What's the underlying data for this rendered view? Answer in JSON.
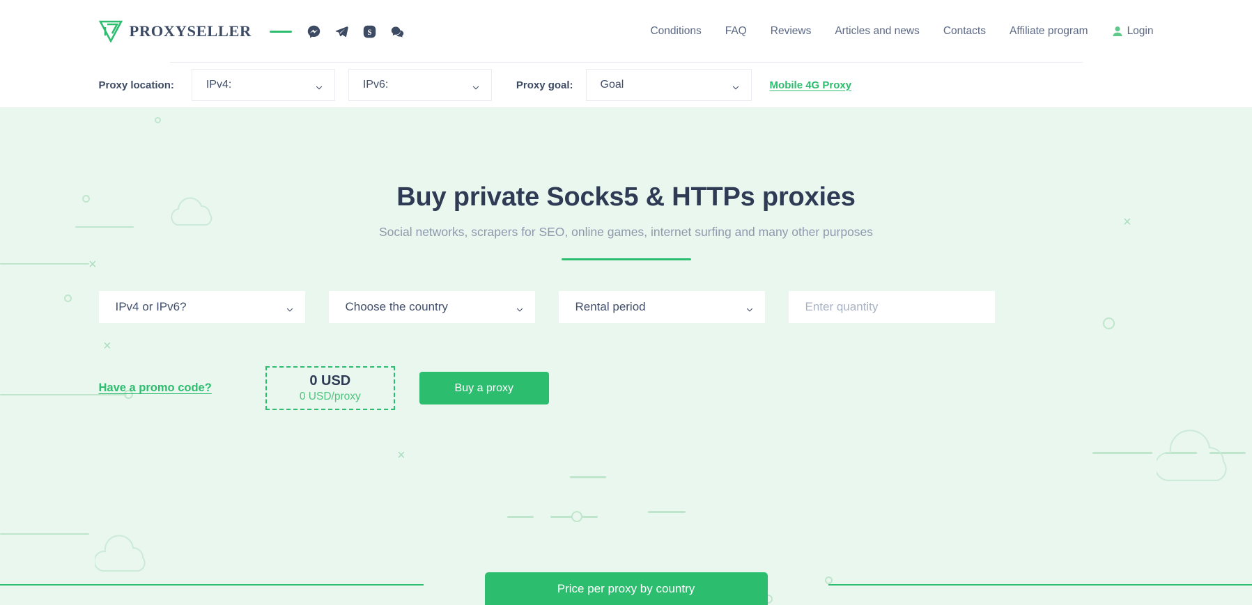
{
  "brand": {
    "name": "PROXYSELLER",
    "logo_icon": "proxyseller-v-logo-icon"
  },
  "socials": [
    {
      "name": "messenger-icon",
      "label": "Messenger"
    },
    {
      "name": "telegram-icon",
      "label": "Telegram"
    },
    {
      "name": "skype-icon",
      "label": "Skype"
    },
    {
      "name": "chat-icon",
      "label": "Chat"
    }
  ],
  "nav": {
    "items": [
      {
        "label": "Conditions",
        "name": "conditions"
      },
      {
        "label": "FAQ",
        "name": "faq"
      },
      {
        "label": "Reviews",
        "name": "reviews"
      },
      {
        "label": "Articles and news",
        "name": "articles-and-news"
      },
      {
        "label": "Contacts",
        "name": "contacts"
      },
      {
        "label": "Affiliate program",
        "name": "affiliate-program"
      }
    ],
    "login": {
      "label": "Login",
      "icon": "user-icon"
    }
  },
  "filter_bar": {
    "location_label": "Proxy location:",
    "ipv4_value": "IPv4:",
    "ipv6_value": "IPv6:",
    "goal_label": "Proxy goal:",
    "goal_value": "Goal",
    "mobile_link": "Mobile 4G Proxy"
  },
  "hero": {
    "title": "Buy private Socks5 & HTTPs proxies",
    "subtitle": "Social networks, scrapers for SEO, online games, internet surfing and many other purposes",
    "background_color": "#eaf7ee"
  },
  "order_form": {
    "ip_version_value": "IPv4 or IPv6?",
    "country_value": "Choose the country",
    "rental_period_value": "Rental period",
    "quantity_placeholder": "Enter quantity",
    "quantity_value": ""
  },
  "actions": {
    "promo_label": "Have a promo code?",
    "price_total": "0 USD",
    "price_per_proxy": "0 USD/proxy",
    "buy_label": "Buy a proxy",
    "price_by_country_label": "Price per proxy by country"
  },
  "colors": {
    "accent_green": "#2dbd6e",
    "text_dark": "#2f3b54",
    "text_muted": "#8e99ad",
    "nav_text": "#5b6884",
    "hero_bg": "#eaf7ee"
  }
}
